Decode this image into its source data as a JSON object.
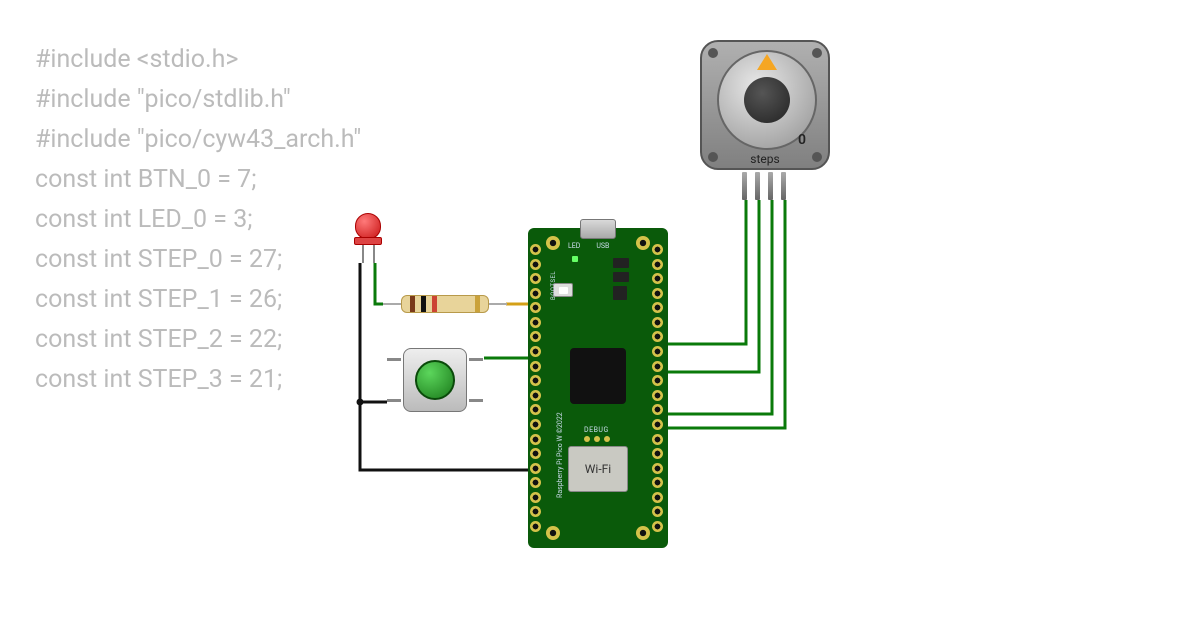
{
  "code_lines": [
    "#include <stdio.h>",
    "#include \"pico/stdlib.h\"",
    "#include \"pico/cyw43_arch.h\"",
    "",
    "const int BTN_0 = 7;",
    "const int LED_0 = 3;",
    "",
    "const int STEP_0 = 27;",
    "const int STEP_1 = 26;",
    "const int STEP_2 = 22;",
    "const int STEP_3 = 21;"
  ],
  "stepper": {
    "count": "0",
    "label": "steps"
  },
  "pico": {
    "led_label": "LED",
    "usb_label": "USB",
    "bootsel_label": "BOOTSEL",
    "debug_label": "DEBUG",
    "wifi_label": "Wi-Fi",
    "side_label": "Raspberry Pi Pico W ©2022"
  },
  "components": {
    "led": "red-led",
    "resistor": "resistor",
    "button": "push-button",
    "stepper": "stepper-motor",
    "board": "raspberry-pi-pico-w"
  },
  "wires": [
    {
      "name": "led-cathode-to-gnd",
      "color": "#111"
    },
    {
      "name": "led-anode-to-resistor",
      "color": "#0a7a0a"
    },
    {
      "name": "resistor-to-gp3",
      "color": "#d4a017"
    },
    {
      "name": "button-to-gp7",
      "color": "#0a7a0a"
    },
    {
      "name": "button-to-gnd",
      "color": "#111"
    },
    {
      "name": "stepper-a-to-gp27",
      "color": "#0a7a0a"
    },
    {
      "name": "stepper-b-to-gp26",
      "color": "#0a7a0a"
    },
    {
      "name": "stepper-c-to-gp22",
      "color": "#0a7a0a"
    },
    {
      "name": "stepper-d-to-gp21",
      "color": "#0a7a0a"
    }
  ]
}
